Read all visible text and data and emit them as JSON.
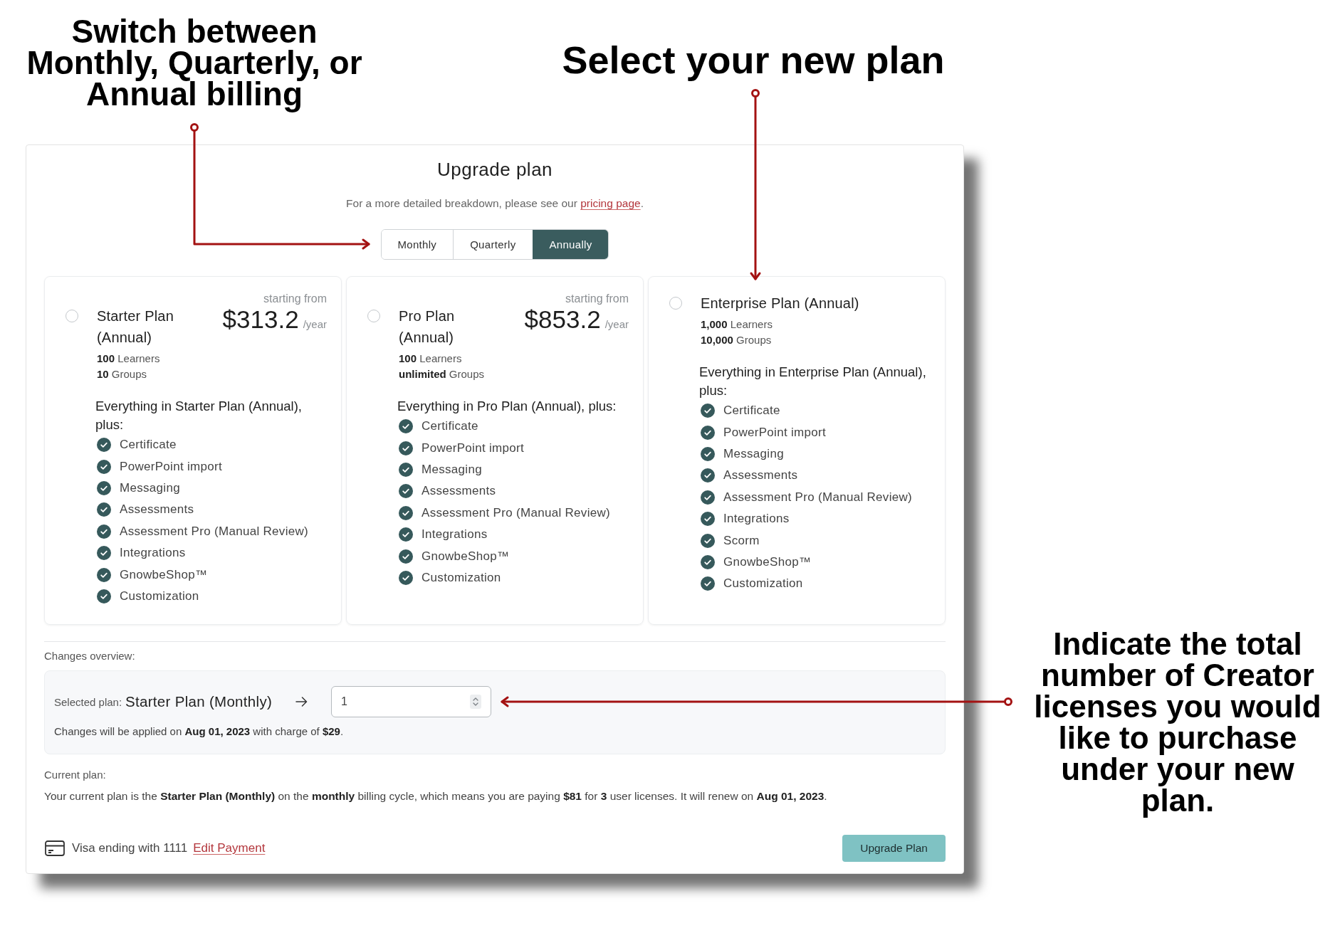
{
  "annotations": [
    {
      "text": "Switch between Monthly, Quarterly, or Annual billing"
    },
    {
      "text": "Select your new plan"
    },
    {
      "text": "Indicate the total number of Creator licenses you would like to purchase under your new plan."
    }
  ],
  "dialog": {
    "title": "Upgrade plan",
    "subtitle": "For a more detailed breakdown, please see our",
    "subtitle_link": "pricing page",
    "subtitle_end": "."
  },
  "billing_tabs": [
    {
      "label": "Monthly",
      "selected": false
    },
    {
      "label": "Quarterly",
      "selected": false
    },
    {
      "label": "Annually",
      "selected": true
    }
  ],
  "plans": [
    {
      "name": "Starter Plan (Annual)",
      "selected": false,
      "price_caption": "starting from",
      "price": "$313.2",
      "period": "/year",
      "limits": [
        "**100** Learners",
        "**10** Groups"
      ],
      "features_heading": "Everything in Starter Plan (Annual), plus:",
      "features": [
        "Certificate",
        "PowerPoint import",
        "Messaging",
        "Assessments",
        "Assessment Pro (Manual Review)",
        "Integrations",
        "GnowbeShop™",
        "Customization"
      ]
    },
    {
      "name": "Pro Plan (Annual)",
      "selected": false,
      "price_caption": "starting from",
      "price": "$853.2",
      "period": "/year",
      "limits": [
        "**100** Learners",
        "**unlimited** Groups"
      ],
      "features_heading": "Everything in Pro Plan (Annual), plus:",
      "features": [
        "Certificate",
        "PowerPoint import",
        "Messaging",
        "Assessments",
        "Assessment Pro (Manual Review)",
        "Integrations",
        "GnowbeShop™",
        "Customization"
      ]
    },
    {
      "name": "Enterprise Plan (Annual)",
      "selected": false,
      "limits": [
        "**1,000** Learners",
        "**10,000** Groups"
      ],
      "features_heading": "Everything in Enterprise Plan (Annual), plus:",
      "features": [
        "Certificate",
        "PowerPoint import",
        "Messaging",
        "Assessments",
        "Assessment Pro (Manual Review)",
        "Integrations",
        "Scorm",
        "GnowbeShop™",
        "Customization"
      ]
    }
  ],
  "changes_overview": {
    "heading": "Changes overview:",
    "selected_label": "Selected plan:",
    "selected_plan": "Starter Plan (Monthly)",
    "licenses": {
      "value": "1"
    },
    "note": "Changes will be applied on **Aug 01, 2023** with charge of **$29**."
  },
  "current_plan": {
    "heading": "Current plan:",
    "text": "Your current plan is the **Starter Plan (Monthly)** on the **monthly** billing cycle, which means you are paying **$81** for **3** user licenses. It will renew on **Aug 01, 2023**."
  },
  "payment": {
    "card_text": "Visa ending with 1111",
    "edit_link": "Edit Payment"
  },
  "upgrade_button": "Upgrade Plan"
}
